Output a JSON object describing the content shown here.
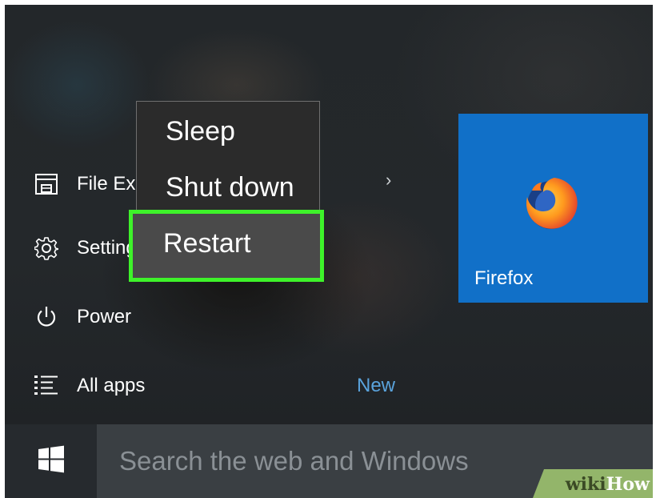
{
  "start_menu": {
    "items": [
      {
        "label": "File Explorer",
        "icon": "file-explorer-icon"
      },
      {
        "label": "Settings",
        "icon": "gear-icon"
      },
      {
        "label": "Power",
        "icon": "power-icon"
      },
      {
        "label": "All apps",
        "icon": "list-icon"
      }
    ],
    "new_label": "New",
    "chevron": "›"
  },
  "power_menu": {
    "options": [
      "Sleep",
      "Shut down",
      "Restart"
    ],
    "highlighted": "Restart",
    "highlight_color": "#3ef22a"
  },
  "tiles": [
    {
      "label": "Firefox",
      "icon": "firefox-icon",
      "color": "#1170c8"
    }
  ],
  "taskbar": {
    "start_icon": "windows-logo-icon",
    "search_placeholder": "Search the web and Windows"
  },
  "watermark": {
    "part1": "wiki",
    "part2": "How"
  }
}
